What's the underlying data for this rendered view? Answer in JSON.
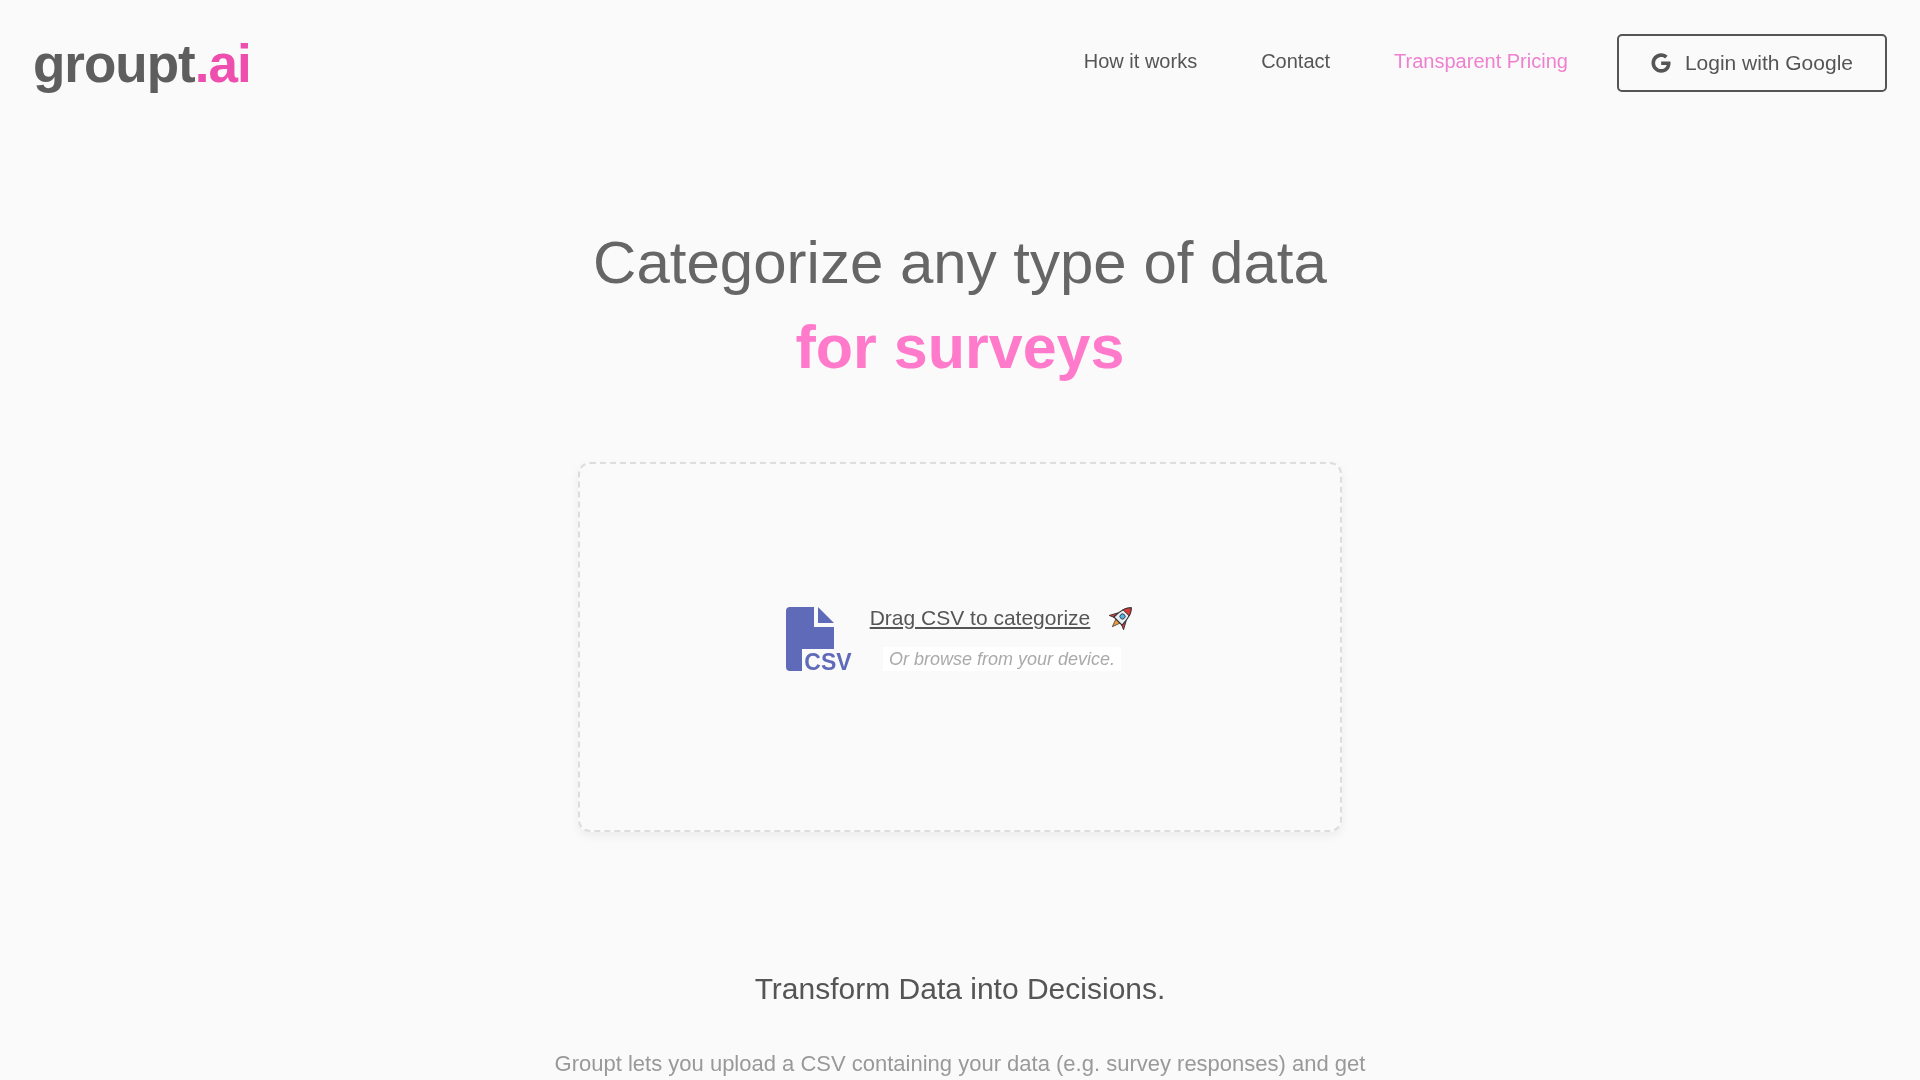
{
  "header": {
    "logo": {
      "name": "groupt",
      "suffix": ".ai"
    },
    "nav": [
      {
        "label": "How it works",
        "highlighted": false
      },
      {
        "label": "Contact",
        "highlighted": false
      },
      {
        "label": "Transparent Pricing",
        "highlighted": true
      }
    ],
    "login_button": {
      "label": "Login with Google"
    }
  },
  "hero": {
    "title": "Categorize any type of data",
    "title_accent": "for surveys"
  },
  "upload": {
    "file_icon_text": "CSV",
    "prompt": "Drag CSV to categorize",
    "hint": "Or browse from your device."
  },
  "intro": {
    "heading": "Transform Data into Decisions.",
    "text": "Groupt lets you upload a CSV containing your data (e.g. survey responses) and get"
  }
}
